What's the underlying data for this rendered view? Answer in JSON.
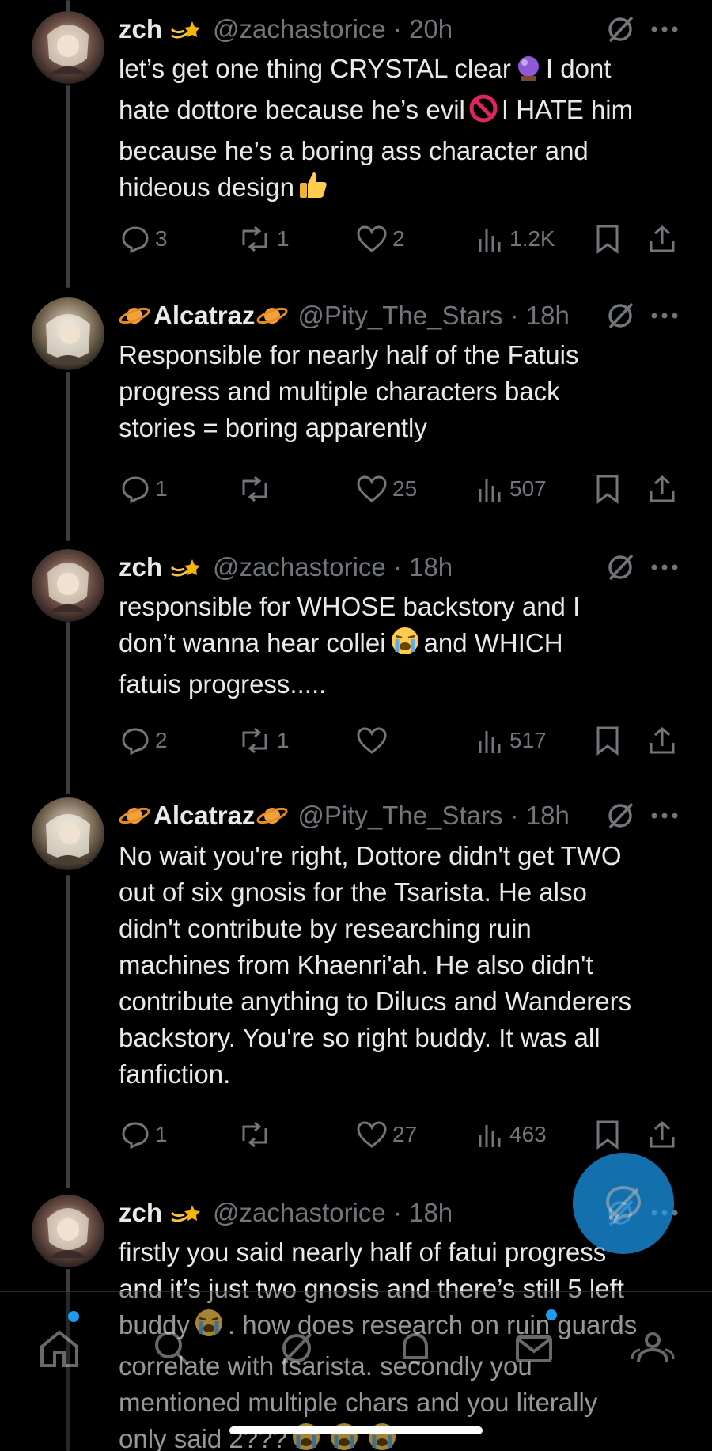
{
  "tweets": [
    {
      "name": "zch",
      "handle": "@zachastorice · 20h",
      "lines": [
        "let’s get one thing CRYSTAL clear",
        "I dont",
        "hate dottore because he’s evil",
        "I HATE him",
        "because he’s a boring ass character and",
        "hideous design"
      ],
      "replies": "3",
      "reposts": "1",
      "likes": "2",
      "views": "1.2K"
    },
    {
      "name": "Alcatraz",
      "handle": "@Pity_The_Stars · 18h",
      "lines": [
        "Responsible for nearly half of the Fatuis",
        "progress and multiple characters back",
        "stories = boring apparently"
      ],
      "replies": "1",
      "reposts": "",
      "likes": "25",
      "views": "507"
    },
    {
      "name": "zch",
      "handle": "@zachastorice · 18h",
      "lines": [
        "responsible for WHOSE backstory and I",
        "don’t wanna hear collei",
        "and WHICH",
        "fatuis progress....."
      ],
      "replies": "2",
      "reposts": "1",
      "likes": "",
      "views": "517"
    },
    {
      "name": "Alcatraz",
      "handle": "@Pity_The_Stars · 18h",
      "lines": [
        "No wait you're right, Dottore didn't get TWO",
        "out of six gnosis for the Tsarista. He also",
        "didn't contribute by researching ruin",
        "machines from Khaenri'ah. He also didn't",
        "contribute anything to Dilucs and Wanderers",
        "backstory. You're so right buddy. It was all",
        "fanfiction."
      ],
      "replies": "1",
      "reposts": "",
      "likes": "27",
      "views": "463"
    },
    {
      "name": "zch",
      "handle": "@zachastorice · 18h",
      "lines": [
        "firstly you said nearly half of fatui progress",
        "and it’s just two gnosis and there’s still 5 left",
        "buddy",
        ". how does research on ruin guards",
        "correlate with tsarista. secondly you",
        "mentioned multiple chars and you literally",
        "only said 2???"
      ]
    }
  ],
  "icons": {
    "reply": "reply-icon",
    "repost": "repost-icon",
    "like": "heart-icon",
    "views": "views-icon",
    "bookmark": "bookmark-icon",
    "share": "share-icon",
    "grok": "grok-icon",
    "more": "more-icon"
  },
  "nav": [
    "home-icon",
    "search-icon",
    "grok-icon",
    "notifications-icon",
    "messages-icon",
    "communities-icon"
  ],
  "colors": {
    "accent": "#1d9bf0",
    "text": "#e7e9ea",
    "muted": "#71767b",
    "background": "#000000"
  }
}
